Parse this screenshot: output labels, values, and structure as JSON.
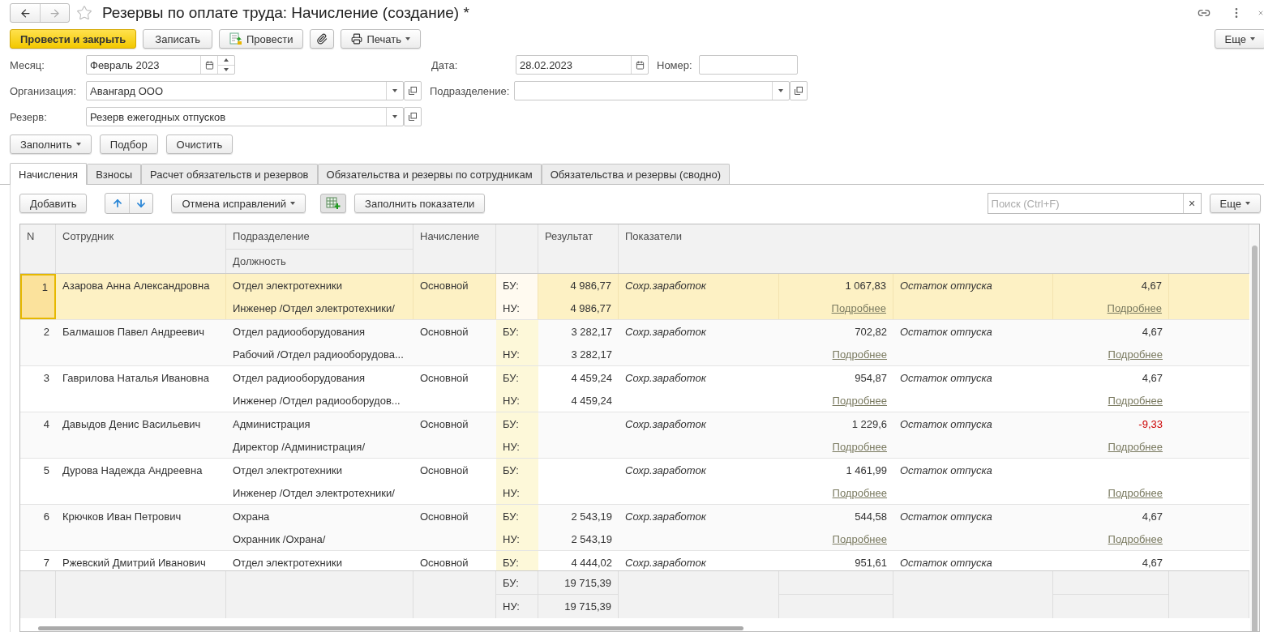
{
  "window": {
    "title": "Резервы по оплате труда: Начисление (создание) *"
  },
  "toolbar": {
    "buttons": [
      {
        "kind": "primary",
        "label": "Провести и закрыть"
      },
      {
        "kind": "plain",
        "label": "Записать"
      },
      {
        "kind": "post",
        "label": "Провести"
      },
      {
        "kind": "attach"
      },
      {
        "kind": "print",
        "label": "Печать"
      }
    ],
    "more": "Еще"
  },
  "fields": {
    "month": {
      "label": "Месяц:",
      "value": "Февраль 2023"
    },
    "date": {
      "label": "Дата:",
      "value": "28.02.2023"
    },
    "number": {
      "label": "Номер:"
    },
    "organization": {
      "label": "Организация:",
      "value": "Авангард ООО"
    },
    "department": {
      "label": "Подразделение:"
    },
    "reserve": {
      "label": "Резерв:",
      "value": "Резерв ежегодных отпусков"
    }
  },
  "fill_buttons": [
    {
      "label": "Заполнить",
      "dropdown": true
    },
    {
      "label": "Подбор",
      "dropdown": false
    },
    {
      "label": "Очистить",
      "dropdown": false
    }
  ],
  "tabs": [
    {
      "label": "Начисления",
      "selected": true
    },
    {
      "label": "Взносы",
      "selected": false
    },
    {
      "label": "Расчет обязательств и резервов",
      "selected": false
    },
    {
      "label": "Обязательства и резервы по сотрудникам",
      "selected": false
    },
    {
      "label": "Обязательства и резервы (сводно)",
      "selected": false
    }
  ],
  "table_toolbar": {
    "add": "Добавить",
    "cancel": "Отмена исправлений",
    "fill": "Заполнить показатели",
    "search_placeholder": "Поиск (Ctrl+F)",
    "clear": "×",
    "more": "Еще"
  },
  "table": {
    "columns": {
      "n": "N",
      "employee": "Сотрудник",
      "department": "Подразделение",
      "position": "Должность",
      "accrual": "Начисление",
      "result": "Результат",
      "indicators": "Показатели"
    },
    "rows": [
      {
        "n": "1",
        "employee": "Азарова Анна Александровна",
        "department": "Отдел электротехники",
        "position": "Инженер /Отдел электротехники/",
        "accrual": "Основной",
        "bu_label": "БУ:",
        "nu_label": "НУ:",
        "result_bu": "4 986,77",
        "result_nu": "4 986,77",
        "ind1": {
          "name": "Сохр.заработок",
          "value": "1 067,83",
          "link": "Подробнее",
          "negative": false
        },
        "ind2": {
          "name": "Остаток отпуска",
          "value": "4,67",
          "link": "Подробнее",
          "negative": false
        },
        "selected": true
      },
      {
        "n": "2",
        "employee": "Балмашов Павел Андреевич",
        "department": "Отдел радиооборудования",
        "position": "Рабочий /Отдел радиооборудова...",
        "accrual": "Основной",
        "bu_label": "БУ:",
        "nu_label": "НУ:",
        "result_bu": "3 282,17",
        "result_nu": "3 282,17",
        "ind1": {
          "name": "Сохр.заработок",
          "value": "702,82",
          "link": "Подробнее",
          "negative": false
        },
        "ind2": {
          "name": "Остаток отпуска",
          "value": "4,67",
          "link": "Подробнее",
          "negative": false
        },
        "selected": false
      },
      {
        "n": "3",
        "employee": "Гаврилова Наталья Ивановна",
        "department": "Отдел радиооборудования",
        "position": "Инженер /Отдел радиооборудов...",
        "accrual": "Основной",
        "bu_label": "БУ:",
        "nu_label": "НУ:",
        "result_bu": "4 459,24",
        "result_nu": "4 459,24",
        "ind1": {
          "name": "Сохр.заработок",
          "value": "954,87",
          "link": "Подробнее",
          "negative": false
        },
        "ind2": {
          "name": "Остаток отпуска",
          "value": "4,67",
          "link": "Подробнее",
          "negative": false
        },
        "selected": false
      },
      {
        "n": "4",
        "employee": "Давыдов Денис Васильевич",
        "department": "Администрация",
        "position": "Директор /Администрация/",
        "accrual": "Основной",
        "bu_label": "БУ:",
        "nu_label": "НУ:",
        "ind1": {
          "name": "Сохр.заработок",
          "value": "1 229,6",
          "link": "Подробнее",
          "negative": false
        },
        "ind2": {
          "name": "Остаток отпуска",
          "value": "-9,33",
          "link": "Подробнее",
          "negative": true
        },
        "selected": false
      },
      {
        "n": "5",
        "employee": "Дурова Надежда Андреевна",
        "department": "Отдел электротехники",
        "position": "Инженер /Отдел электротехники/",
        "accrual": "Основной",
        "bu_label": "БУ:",
        "nu_label": "НУ:",
        "ind1": {
          "name": "Сохр.заработок",
          "value": "1 461,99",
          "link": "Подробнее",
          "negative": false
        },
        "ind2": {
          "name": "Остаток отпуска",
          "link": "Подробнее"
        },
        "selected": false
      },
      {
        "n": "6",
        "employee": "Крючков Иван Петрович",
        "department": "Охрана",
        "position": "Охранник /Охрана/",
        "accrual": "Основной",
        "bu_label": "БУ:",
        "nu_label": "НУ:",
        "result_bu": "2 543,19",
        "result_nu": "2 543,19",
        "ind1": {
          "name": "Сохр.заработок",
          "value": "544,58",
          "link": "Подробнее",
          "negative": false
        },
        "ind2": {
          "name": "Остаток отпуска",
          "value": "4,67",
          "link": "Подробнее",
          "negative": false
        },
        "selected": false
      },
      {
        "n": "7",
        "employee": "Ржевский Дмитрий Иванович",
        "department": "Отдел электротехники",
        "accrual": "Основной",
        "bu_label": "БУ:",
        "result_bu": "4 444,02",
        "ind1": {
          "name": "Сохр.заработок",
          "value": "951,61",
          "negative": false
        },
        "ind2": {
          "name": "Остаток отпуска",
          "value": "4,67",
          "negative": false
        },
        "selected": false
      }
    ],
    "totals": {
      "bu_label": "БУ:",
      "bu": "19 715,39",
      "nu_label": "НУ:",
      "nu": "19 715,39"
    }
  }
}
